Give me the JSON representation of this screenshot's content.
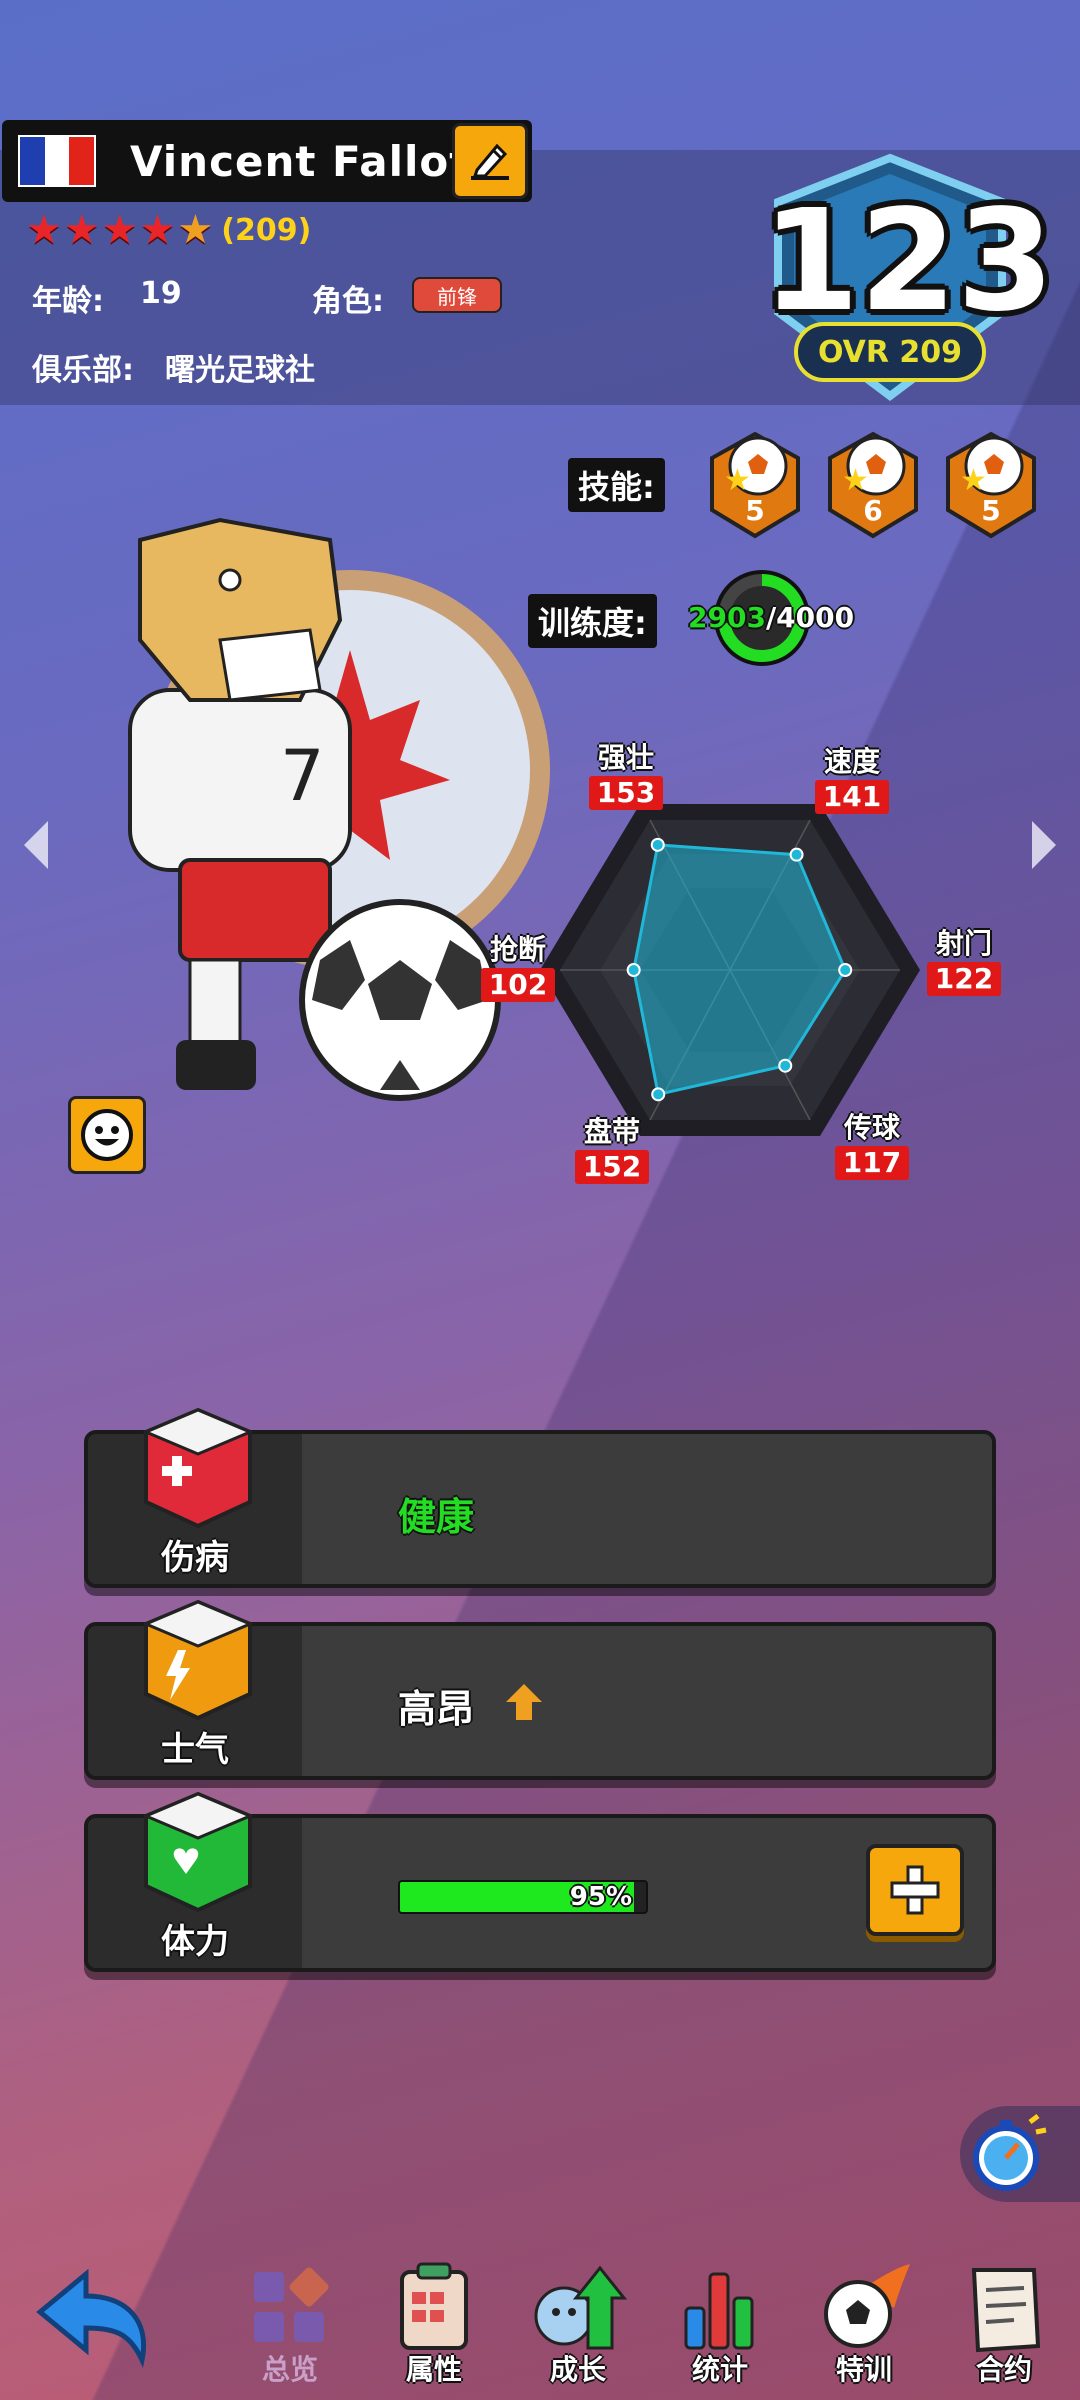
{
  "player": {
    "name": "Vincent Fallot",
    "flag_colors": [
      "#1f3fb0",
      "#ffffff",
      "#e2231a"
    ],
    "star_count_label": "(209)",
    "age_label": "年龄:",
    "age_value": "19",
    "role_label": "角色:",
    "role_value": "前锋",
    "club_label": "俱乐部:",
    "club_value": "曙光足球社",
    "rating": "123",
    "ovr": "OVR 209"
  },
  "skills": {
    "label": "技能:",
    "levels": [
      "5",
      "6",
      "5"
    ]
  },
  "training": {
    "label": "训练度:",
    "current": "2903",
    "separator_max": "/4000",
    "progress": 0.7258
  },
  "stats": [
    {
      "name": "强壮",
      "value": "153"
    },
    {
      "name": "速度",
      "value": "141"
    },
    {
      "name": "射门",
      "value": "122"
    },
    {
      "name": "传球",
      "value": "117"
    },
    {
      "name": "盘带",
      "value": "152"
    },
    {
      "name": "抢断",
      "value": "102"
    }
  ],
  "status": {
    "injury": {
      "title": "伤病",
      "value": "健康"
    },
    "morale": {
      "title": "士气",
      "value": "高昂"
    },
    "stamina": {
      "title": "体力",
      "value": "95%",
      "fraction": 0.95
    }
  },
  "nav": [
    {
      "label": "总览"
    },
    {
      "label": "属性"
    },
    {
      "label": "成长"
    },
    {
      "label": "统计"
    },
    {
      "label": "特训"
    },
    {
      "label": "合约"
    }
  ],
  "colors": {
    "accent_orange": "#f5a70c",
    "stat_red": "#e01818",
    "healthy_green": "#22dd22",
    "radar_cyan": "#1fb8d8"
  }
}
